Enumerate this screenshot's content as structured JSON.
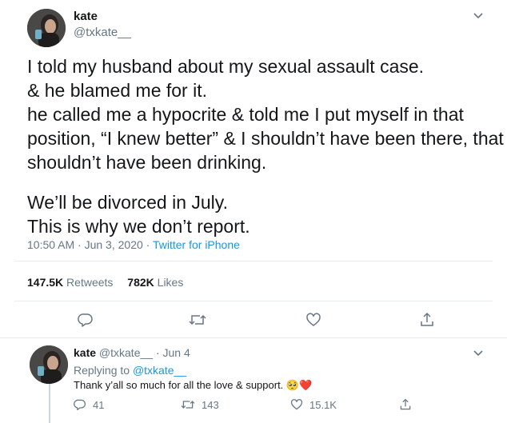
{
  "main_tweet": {
    "display_name": "kate",
    "handle": "@txkate__",
    "lines": [
      "I told my husband about my sexual assault case.",
      "& he blamed me for it.",
      "he called me a hypocrite & told me I put myself in that",
      "position, “I knew better” & I shouldn’t have been there, that I",
      "shouldn’t have been drinking.",
      "",
      "We’ll be divorced in July.",
      "This is why we don’t report."
    ],
    "time": "10:50 AM · Jun 3, 2020 ·",
    "source": "Twitter for iPhone",
    "retweets_count": "147.5K",
    "retweets_label": "Retweets",
    "likes_count": "782K",
    "likes_label": "Likes"
  },
  "reply_tweet": {
    "display_name": "kate",
    "handle": "@txkate__",
    "date": "· Jun 4",
    "replying_prefix": "Replying to",
    "replying_handle": "@txkate__",
    "text": "Thank y’all so much for all the love & support.",
    "emoji": "🥺❤️",
    "reply_count": "41",
    "retweet_count": "143",
    "like_count": "15.1K"
  },
  "colors": {
    "text": "#14171a",
    "muted": "#657786",
    "link": "#1b95e0",
    "divider": "#e6ecf0"
  },
  "icons": [
    "chevron-down-icon",
    "reply-icon",
    "retweet-icon",
    "like-icon",
    "share-icon"
  ]
}
